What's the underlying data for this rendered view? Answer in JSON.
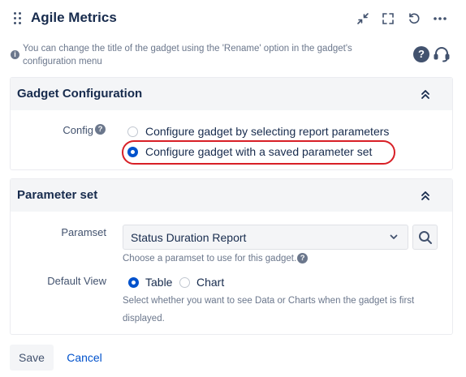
{
  "header": {
    "title": "Agile Metrics"
  },
  "info": {
    "text": "You can change the title of the gadget using the 'Rename' option in the gadget's configuration menu"
  },
  "gadget_config": {
    "title": "Gadget Configuration",
    "config_label": "Config",
    "options": [
      {
        "label": "Configure gadget by selecting report parameters",
        "selected": false
      },
      {
        "label": "Configure gadget with a saved parameter set",
        "selected": true
      }
    ]
  },
  "parameter_set": {
    "title": "Parameter set",
    "paramset_label": "Paramset",
    "paramset_value": "Status Duration Report",
    "paramset_hint": "Choose a paramset to use for this gadget.",
    "default_view_label": "Default View",
    "view_options": [
      {
        "label": "Table",
        "selected": true
      },
      {
        "label": "Chart",
        "selected": false
      }
    ],
    "view_hint": "Select whether you want to see Data or Charts when the gadget is first displayed."
  },
  "footer": {
    "save_label": "Save",
    "cancel_label": "Cancel"
  },
  "colors": {
    "accent": "#0052cc",
    "highlight": "#d81f26",
    "panel_header": "#f4f5f7"
  },
  "icons": [
    "drag-handle-icon",
    "collapse-icon",
    "fullscreen-icon",
    "refresh-icon",
    "more-icon",
    "info-icon",
    "help-icon",
    "support-icon",
    "chevron-up-icon",
    "chevron-down-icon",
    "search-icon"
  ]
}
